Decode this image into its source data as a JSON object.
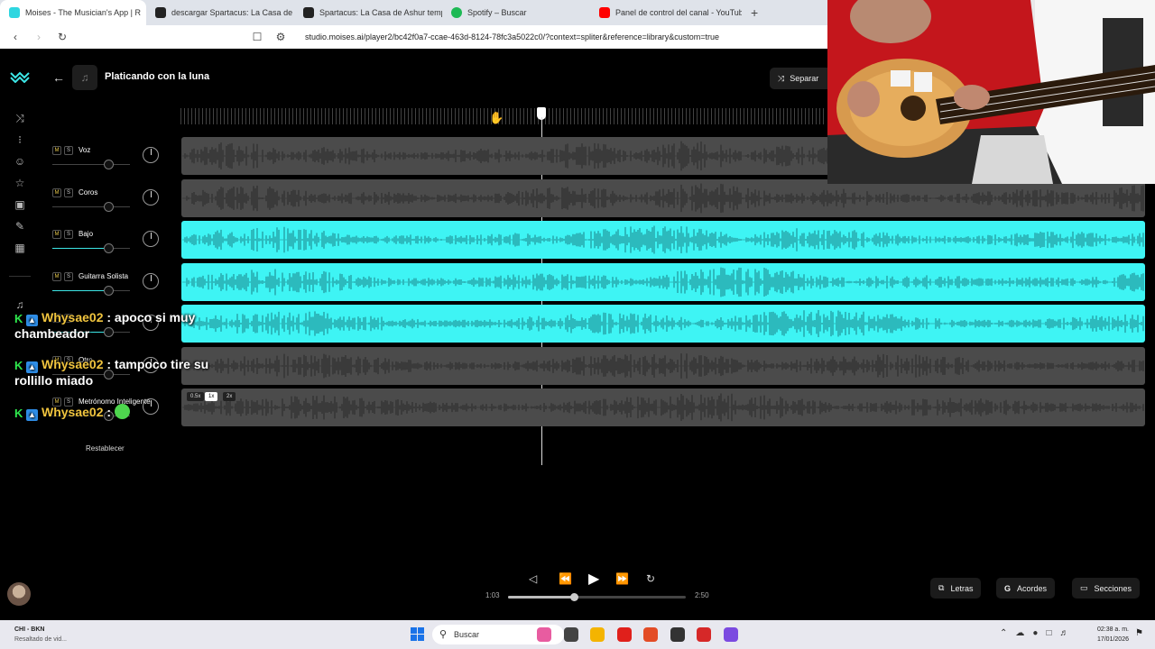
{
  "browser": {
    "tabs": [
      {
        "title": "Moises - The Musician's App | R",
        "color": "#2fd6e0",
        "active": true
      },
      {
        "title": "descargar Spartacus: La Casa de Ash",
        "color": "#222222",
        "active": false
      },
      {
        "title": "Spartacus: La Casa de Ashur tempora",
        "color": "#222222",
        "active": false
      },
      {
        "title": "Spotify – Buscar",
        "color": "#1db954",
        "active": false
      },
      {
        "title": "Panel de control del canal - YouTube",
        "color": "#ff0000",
        "active": false
      }
    ],
    "close_glyph": "×",
    "new_tab_glyph": "+",
    "url": "studio.moises.ai/player2/bc42f0a7-ccae-463d-8124-78fc3a5022c0/?context=spliter&reference=library&custom=true"
  },
  "song": {
    "title": "Platicando con la luna"
  },
  "toolbar": {
    "separar_label": "Separar"
  },
  "tracks": [
    {
      "name": "Voz",
      "volume": 0.72,
      "lane": "gray"
    },
    {
      "name": "Coros",
      "volume": 0.72,
      "lane": "gray"
    },
    {
      "name": "Bajo",
      "volume": 0.72,
      "lane": "cyan"
    },
    {
      "name": "Guitarra Solista",
      "volume": 0.72,
      "lane": "cyan"
    },
    {
      "name": "",
      "volume": 0.72,
      "lane": "cyan"
    },
    {
      "name": "Otro",
      "volume": 0.72,
      "lane": "gray"
    },
    {
      "name": "Metrónomo Inteligente",
      "volume": 0.72,
      "lane": "gray"
    }
  ],
  "mute_label": "M",
  "solo_label": "S",
  "speed_options": [
    "0.5x",
    "1x",
    "2x"
  ],
  "speed_selected": "1x",
  "reset_label": "Restablecer",
  "chat": [
    {
      "user": "Whysae02",
      "text": " : apoco si muy",
      "text2": "chambeador"
    },
    {
      "user": "Whysae02",
      "text": " : tampoco tire su",
      "text2": "rollillo miado"
    },
    {
      "user": "Whysae02",
      "text": " :",
      "text2": ""
    }
  ],
  "player": {
    "current_time": "1:03",
    "total_time": "2:50",
    "progress": 0.37
  },
  "side_buttons": [
    {
      "label": "Letras",
      "icon": "lyrics-icon",
      "glyph": "⧉"
    },
    {
      "label": "Acordes",
      "icon": "chords-icon",
      "glyph": "G"
    },
    {
      "label": "Secciones",
      "icon": "sections-icon",
      "glyph": "▭"
    }
  ],
  "taskbar": {
    "news_title": "CHI - BKN",
    "news_sub": "Resaltado de vid...",
    "search_placeholder": "Buscar",
    "time": "02:38 a. m.",
    "date": "17/01/2026",
    "app_colors": [
      "#e85ca0",
      "#444444",
      "#f4b400",
      "#e0201b",
      "#e34c26",
      "#333333",
      "#d62828",
      "#7b4ae0"
    ]
  }
}
